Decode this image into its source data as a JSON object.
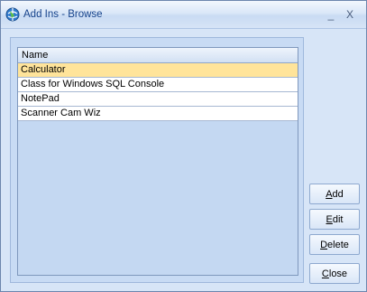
{
  "window": {
    "title": "Add Ins - Browse",
    "minimize_glyph": "_",
    "close_glyph": "X"
  },
  "grid": {
    "column_header": "Name",
    "rows": [
      "Calculator",
      "Class for Windows SQL Console",
      "NotePad",
      "Scanner Cam Wiz"
    ],
    "selected_index": 0
  },
  "buttons": {
    "add": {
      "mnemonic": "A",
      "rest": "dd"
    },
    "edit": {
      "mnemonic": "E",
      "rest": "dit"
    },
    "delete": {
      "mnemonic": "D",
      "rest": "elete"
    },
    "close": {
      "mnemonic": "C",
      "rest": "lose"
    }
  },
  "colors": {
    "accent_title": "#15428b",
    "selected_row": "#ffe49a",
    "window_bg": "#d7e5f7"
  },
  "icons": {
    "app": "add-ins-globe-icon"
  }
}
